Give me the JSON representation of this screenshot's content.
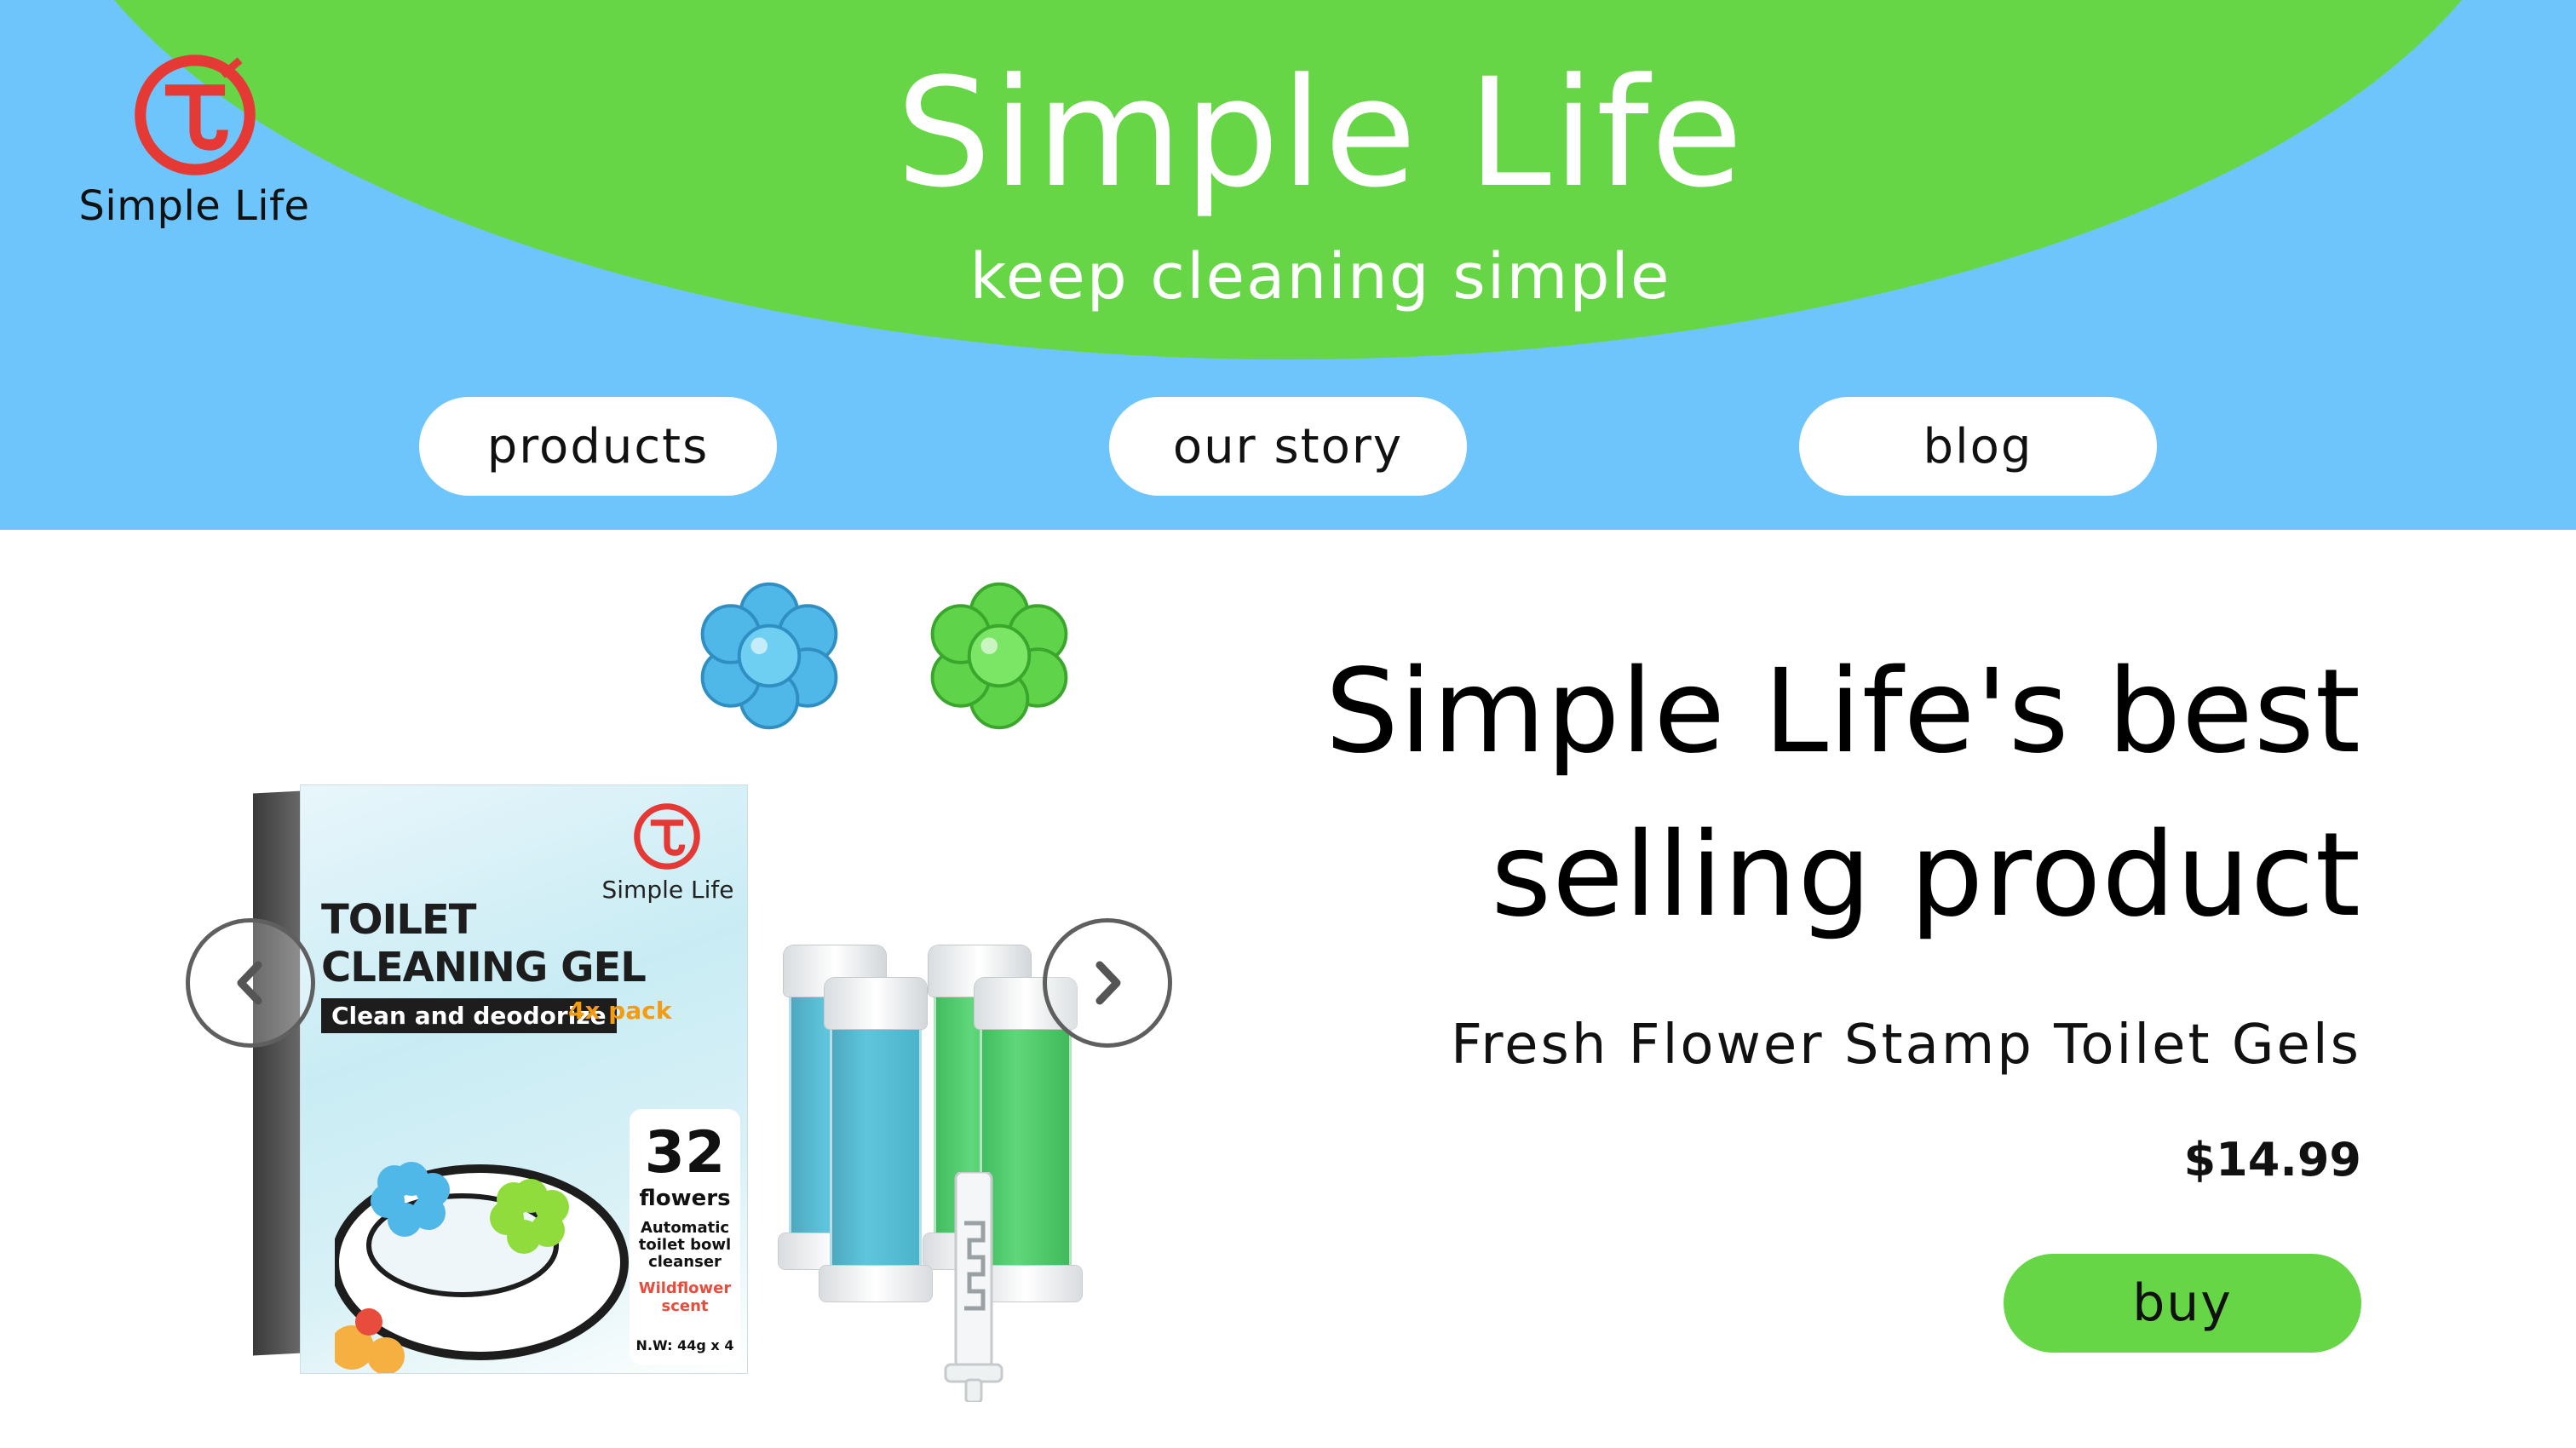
{
  "brand": {
    "logo_text": "Simple Life",
    "title": "Simple Life",
    "tagline": "keep cleaning simple",
    "logo_color": "#e53935"
  },
  "nav": {
    "items": [
      {
        "label": "products"
      },
      {
        "label": "our story"
      },
      {
        "label": "blog"
      }
    ]
  },
  "colors": {
    "header_blue": "#6ec5fb",
    "header_green": "#66d647",
    "buy_button": "#66d647"
  },
  "product": {
    "headline_line1": "Simple Life's best",
    "headline_line2": "selling product",
    "name": "Fresh Flower Stamp Toilet Gels",
    "price": "$14.99",
    "buy_label": "buy",
    "image": {
      "brand": "Simple Life",
      "title_line1": "TOILET",
      "title_line2": "CLEANING GEL",
      "strip": "Clean and deodorize",
      "pack": "4x pack",
      "count": "32",
      "count_label": "flowers",
      "desc_line1": "Automatic",
      "desc_line2": "toilet bowl",
      "desc_line3": "cleanser",
      "scent_line1": "Wildflower",
      "scent_line2": "scent",
      "weight": "N.W: 44g x 4"
    }
  },
  "carousel": {
    "prev_icon": "chevron-left-icon",
    "next_icon": "chevron-right-icon"
  }
}
